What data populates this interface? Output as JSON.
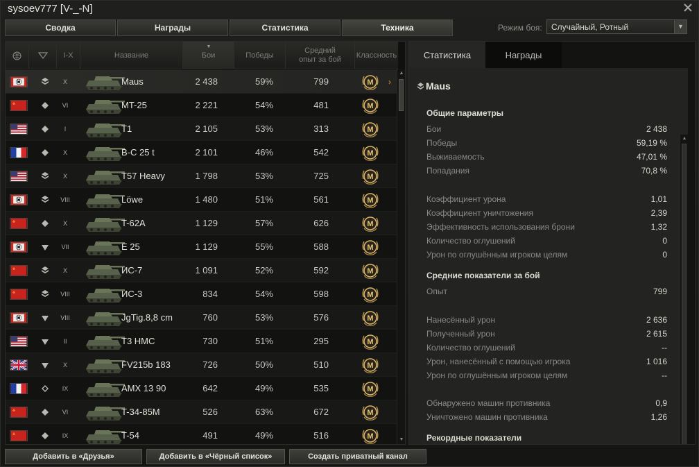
{
  "window": {
    "title": "sysoev777 [V-_-N]"
  },
  "tabs": [
    "Сводка",
    "Награды",
    "Статистика",
    "Техника"
  ],
  "battle_mode": {
    "label": "Режим боя:",
    "value": "Случайный, Ротный"
  },
  "table": {
    "headers": {
      "tier": "I-X",
      "name": "Название",
      "battles": "Бои",
      "wins": "Победы",
      "avg_xp": "Средний опыт за бой",
      "mastery": "Классность"
    },
    "rows": [
      {
        "nation": "germany",
        "type": "heavy",
        "tier": "X",
        "name": "Maus",
        "battles": "2 438",
        "wins": "59%",
        "xp": "799"
      },
      {
        "nation": "ussr",
        "type": "medium",
        "tier": "VI",
        "name": "MT-25",
        "battles": "2 221",
        "wins": "54%",
        "xp": "481"
      },
      {
        "nation": "usa",
        "type": "medium",
        "tier": "I",
        "name": "T1",
        "battles": "2 105",
        "wins": "53%",
        "xp": "313"
      },
      {
        "nation": "france",
        "type": "medium",
        "tier": "X",
        "name": "B-C 25 t",
        "battles": "2 101",
        "wins": "46%",
        "xp": "542"
      },
      {
        "nation": "usa",
        "type": "heavy",
        "tier": "X",
        "name": "T57 Heavy",
        "battles": "1 798",
        "wins": "53%",
        "xp": "725"
      },
      {
        "nation": "germany",
        "type": "heavy",
        "tier": "VIII",
        "name": "Löwe",
        "battles": "1 480",
        "wins": "51%",
        "xp": "561"
      },
      {
        "nation": "ussr",
        "type": "medium",
        "tier": "X",
        "name": "T-62A",
        "battles": "1 129",
        "wins": "57%",
        "xp": "626"
      },
      {
        "nation": "germany",
        "type": "td",
        "tier": "VII",
        "name": "E 25",
        "battles": "1 129",
        "wins": "55%",
        "xp": "588"
      },
      {
        "nation": "ussr",
        "type": "heavy",
        "tier": "X",
        "name": "ИС-7",
        "battles": "1 091",
        "wins": "52%",
        "xp": "592"
      },
      {
        "nation": "ussr",
        "type": "heavy",
        "tier": "VIII",
        "name": "ИС-3",
        "battles": "834",
        "wins": "54%",
        "xp": "598"
      },
      {
        "nation": "germany",
        "type": "td",
        "tier": "VIII",
        "name": "JgTig.8,8 cm",
        "battles": "760",
        "wins": "53%",
        "xp": "576"
      },
      {
        "nation": "usa",
        "type": "td",
        "tier": "II",
        "name": "T3 HMC",
        "battles": "730",
        "wins": "51%",
        "xp": "295"
      },
      {
        "nation": "uk",
        "type": "td",
        "tier": "X",
        "name": "FV215b 183",
        "battles": "726",
        "wins": "50%",
        "xp": "510"
      },
      {
        "nation": "france",
        "type": "light",
        "tier": "IX",
        "name": "AMX 13 90",
        "battles": "642",
        "wins": "49%",
        "xp": "535"
      },
      {
        "nation": "ussr",
        "type": "medium",
        "tier": "VI",
        "name": "T-34-85M",
        "battles": "526",
        "wins": "63%",
        "xp": "672"
      },
      {
        "nation": "ussr",
        "type": "medium",
        "tier": "IX",
        "name": "T-54",
        "battles": "491",
        "wins": "49%",
        "xp": "516"
      }
    ],
    "mastery_badge_text": "M"
  },
  "panel": {
    "tabs": [
      "Статистика",
      "Награды"
    ],
    "vehicle": "Maus",
    "sections": [
      {
        "title": "Общие параметры",
        "items": [
          {
            "k": "Бои",
            "v": "2 438"
          },
          {
            "k": "Победы",
            "v": "59,19 %"
          },
          {
            "k": "Выживаемость",
            "v": "47,01 %"
          },
          {
            "k": "Попадания",
            "v": "70,8 %"
          }
        ]
      },
      {
        "title": "",
        "items": [
          {
            "k": "Коэффициент урона",
            "v": "1,01"
          },
          {
            "k": "Коэффициент уничтожения",
            "v": "2,39"
          },
          {
            "k": "Эффективность использования брони",
            "v": "1,32"
          },
          {
            "k": "Количество оглушений",
            "v": "0"
          },
          {
            "k": "Урон по оглушённым игроком целям",
            "v": "0"
          }
        ]
      },
      {
        "title": "Средние показатели за бой",
        "items": [
          {
            "k": "Опыт",
            "v": "799"
          }
        ]
      },
      {
        "title": "",
        "items": [
          {
            "k": "Нанесённый урон",
            "v": "2 636"
          },
          {
            "k": "Полученный урон",
            "v": "2 615"
          },
          {
            "k": "Количество оглушений",
            "v": "--"
          },
          {
            "k": "Урон, нанесённый с помощью игрока",
            "v": "1 016"
          },
          {
            "k": "Урон по оглушённым игроком целям",
            "v": "--"
          }
        ]
      },
      {
        "title": "",
        "items": [
          {
            "k": "Обнаружено машин противника",
            "v": "0,9"
          },
          {
            "k": "Уничтожено машин противника",
            "v": "1,26"
          }
        ]
      },
      {
        "title": "Рекордные показатели",
        "items": []
      }
    ]
  },
  "buttons": [
    "Добавить в «Друзья»",
    "Добавить в «Чёрный список»",
    "Создать приватный канал"
  ],
  "colors": {
    "accent": "#e29a2b",
    "badge": "#d9b46a"
  }
}
